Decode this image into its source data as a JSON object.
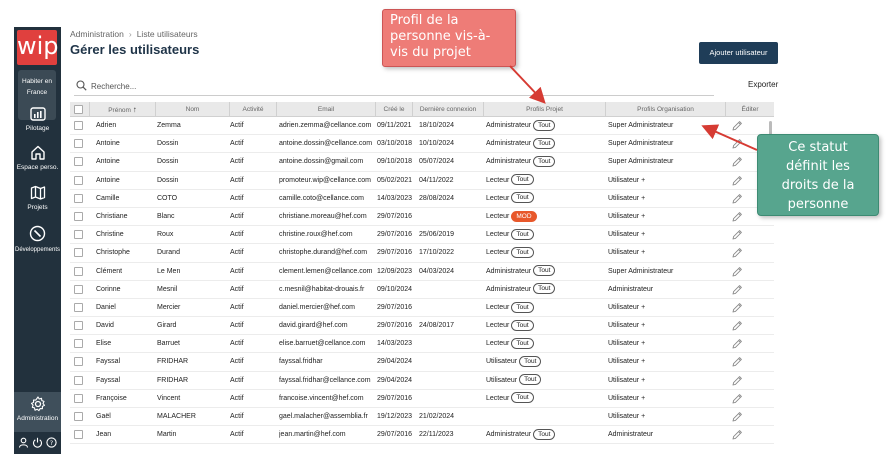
{
  "sidebar": {
    "logo": "wip",
    "org_name_line1": "Habiter en",
    "org_name_line2": "France",
    "items": [
      {
        "label": "Pilotage",
        "icon": "dashboard-icon"
      },
      {
        "label": "Espace perso.",
        "icon": "home-icon"
      },
      {
        "label": "Projets",
        "icon": "map-icon"
      },
      {
        "label": "Développements",
        "icon": "compass-icon"
      }
    ],
    "admin_label": "Administration"
  },
  "breadcrumb": {
    "root": "Administration",
    "current": "Liste utilisateurs"
  },
  "page_title": "Gérer les utilisateurs",
  "add_user_label": "Ajouter utilisateur",
  "search": {
    "placeholder": "Recherche..."
  },
  "export_label": "Exporter",
  "table": {
    "headers": [
      "Prénom",
      "Nom",
      "Activité",
      "Email",
      "Créé le",
      "Dernière connexion",
      "Profils Projet",
      "Profils Organisation",
      "Éditer"
    ],
    "rows": [
      {
        "prenom": "Adrien",
        "nom": "Zemma",
        "activite": "Actif",
        "email": "adrien.zemma@cellance.com",
        "cree": "09/11/2021",
        "derniere": "18/10/2024",
        "profil_projet": "Administrateur",
        "tag": "Tout",
        "profil_org": "Super Administrateur"
      },
      {
        "prenom": "Antoine",
        "nom": "Dossin",
        "activite": "Actif",
        "email": "antoine.dossin@cellance.com",
        "cree": "03/10/2018",
        "derniere": "10/10/2024",
        "profil_projet": "Administrateur",
        "tag": "Tout",
        "profil_org": "Super Administrateur"
      },
      {
        "prenom": "Antoine",
        "nom": "Dossin",
        "activite": "Actif",
        "email": "antoine.dossin@gmail.com",
        "cree": "09/10/2018",
        "derniere": "05/07/2024",
        "profil_projet": "Administrateur",
        "tag": "Tout",
        "profil_org": "Super Administrateur"
      },
      {
        "prenom": "Antoine",
        "nom": "Dossin",
        "activite": "Actif",
        "email": "promoteur.wip@cellance.com",
        "cree": "05/02/2021",
        "derniere": "04/11/2022",
        "profil_projet": "Lecteur",
        "tag": "Tout",
        "profil_org": "Utilisateur +"
      },
      {
        "prenom": "Camille",
        "nom": "COTO",
        "activite": "Actif",
        "email": "camille.coto@cellance.com",
        "cree": "14/03/2023",
        "derniere": "28/08/2024",
        "profil_projet": "Lecteur",
        "tag": "Tout",
        "profil_org": "Utilisateur +"
      },
      {
        "prenom": "Christiane",
        "nom": "Blanc",
        "activite": "Actif",
        "email": "christiane.moreau@hef.com",
        "cree": "29/07/2016",
        "derniere": "",
        "profil_projet": "Lecteur",
        "tag": "MOD",
        "profil_org": "Utilisateur +"
      },
      {
        "prenom": "Christine",
        "nom": "Roux",
        "activite": "Actif",
        "email": "christine.roux@hef.com",
        "cree": "29/07/2016",
        "derniere": "25/06/2019",
        "profil_projet": "Lecteur",
        "tag": "Tout",
        "profil_org": "Utilisateur +"
      },
      {
        "prenom": "Christophe",
        "nom": "Durand",
        "activite": "Actif",
        "email": "christophe.durand@hef.com",
        "cree": "29/07/2016",
        "derniere": "17/10/2022",
        "profil_projet": "Lecteur",
        "tag": "Tout",
        "profil_org": "Utilisateur +"
      },
      {
        "prenom": "Clément",
        "nom": "Le Men",
        "activite": "Actif",
        "email": "clement.lemen@cellance.com",
        "cree": "12/09/2023",
        "derniere": "04/03/2024",
        "profil_projet": "Administrateur",
        "tag": "Tout",
        "profil_org": "Super Administrateur"
      },
      {
        "prenom": "Corinne",
        "nom": "Mesnil",
        "activite": "Actif",
        "email": "c.mesnil@habitat-drouais.fr",
        "cree": "09/10/2024",
        "derniere": "",
        "profil_projet": "Administrateur",
        "tag": "Tout",
        "profil_org": "Administrateur"
      },
      {
        "prenom": "Daniel",
        "nom": "Mercier",
        "activite": "Actif",
        "email": "daniel.mercier@hef.com",
        "cree": "29/07/2016",
        "derniere": "",
        "profil_projet": "Lecteur",
        "tag": "Tout",
        "profil_org": "Utilisateur +"
      },
      {
        "prenom": "David",
        "nom": "Girard",
        "activite": "Actif",
        "email": "david.girard@hef.com",
        "cree": "29/07/2016",
        "derniere": "24/08/2017",
        "profil_projet": "Lecteur",
        "tag": "Tout",
        "profil_org": "Utilisateur +"
      },
      {
        "prenom": "Elise",
        "nom": "Barruet",
        "activite": "Actif",
        "email": "elise.barruet@cellance.com",
        "cree": "14/03/2023",
        "derniere": "",
        "profil_projet": "Lecteur",
        "tag": "Tout",
        "profil_org": "Utilisateur +"
      },
      {
        "prenom": "Fayssal",
        "nom": "FRIDHAR",
        "activite": "Actif",
        "email": "fayssal.fridhar",
        "cree": "29/04/2024",
        "derniere": "",
        "profil_projet": "Utilisateur",
        "tag": "Tout",
        "profil_org": "Utilisateur +"
      },
      {
        "prenom": "Fayssal",
        "nom": "FRIDHAR",
        "activite": "Actif",
        "email": "fayssal.fridhar@cellance.com",
        "cree": "29/04/2024",
        "derniere": "",
        "profil_projet": "Utilisateur",
        "tag": "Tout",
        "profil_org": "Utilisateur +"
      },
      {
        "prenom": "Françoise",
        "nom": "Vincent",
        "activite": "Actif",
        "email": "francoise.vincent@hef.com",
        "cree": "29/07/2016",
        "derniere": "",
        "profil_projet": "Lecteur",
        "tag": "Tout",
        "profil_org": "Utilisateur +"
      },
      {
        "prenom": "Gaël",
        "nom": "MALACHER",
        "activite": "Actif",
        "email": "gael.malacher@assemblia.fr",
        "cree": "19/12/2023",
        "derniere": "21/02/2024",
        "profil_projet": "",
        "tag": "",
        "profil_org": "Utilisateur +"
      },
      {
        "prenom": "Jean",
        "nom": "Martin",
        "activite": "Actif",
        "email": "jean.martin@hef.com",
        "cree": "29/07/2016",
        "derniere": "22/11/2023",
        "profil_projet": "Administrateur",
        "tag": "Tout",
        "profil_org": "Administrateur"
      }
    ]
  },
  "annotations": {
    "callout1_line1": "Profil de la",
    "callout1_line2": "personne vis-à-",
    "callout1_line3": "vis du projet",
    "callout2_line1": "Ce statut",
    "callout2_line2": "définit les",
    "callout2_line3": "droits de la",
    "callout2_line4": "personne"
  },
  "colors": {
    "sidebar_bg": "#22313d",
    "logo_red": "#e0403e",
    "primary_button": "#1f3d58",
    "mod_tag": "#e8582b",
    "callout_red": "#ee7c77",
    "callout_green": "#57a58e"
  }
}
